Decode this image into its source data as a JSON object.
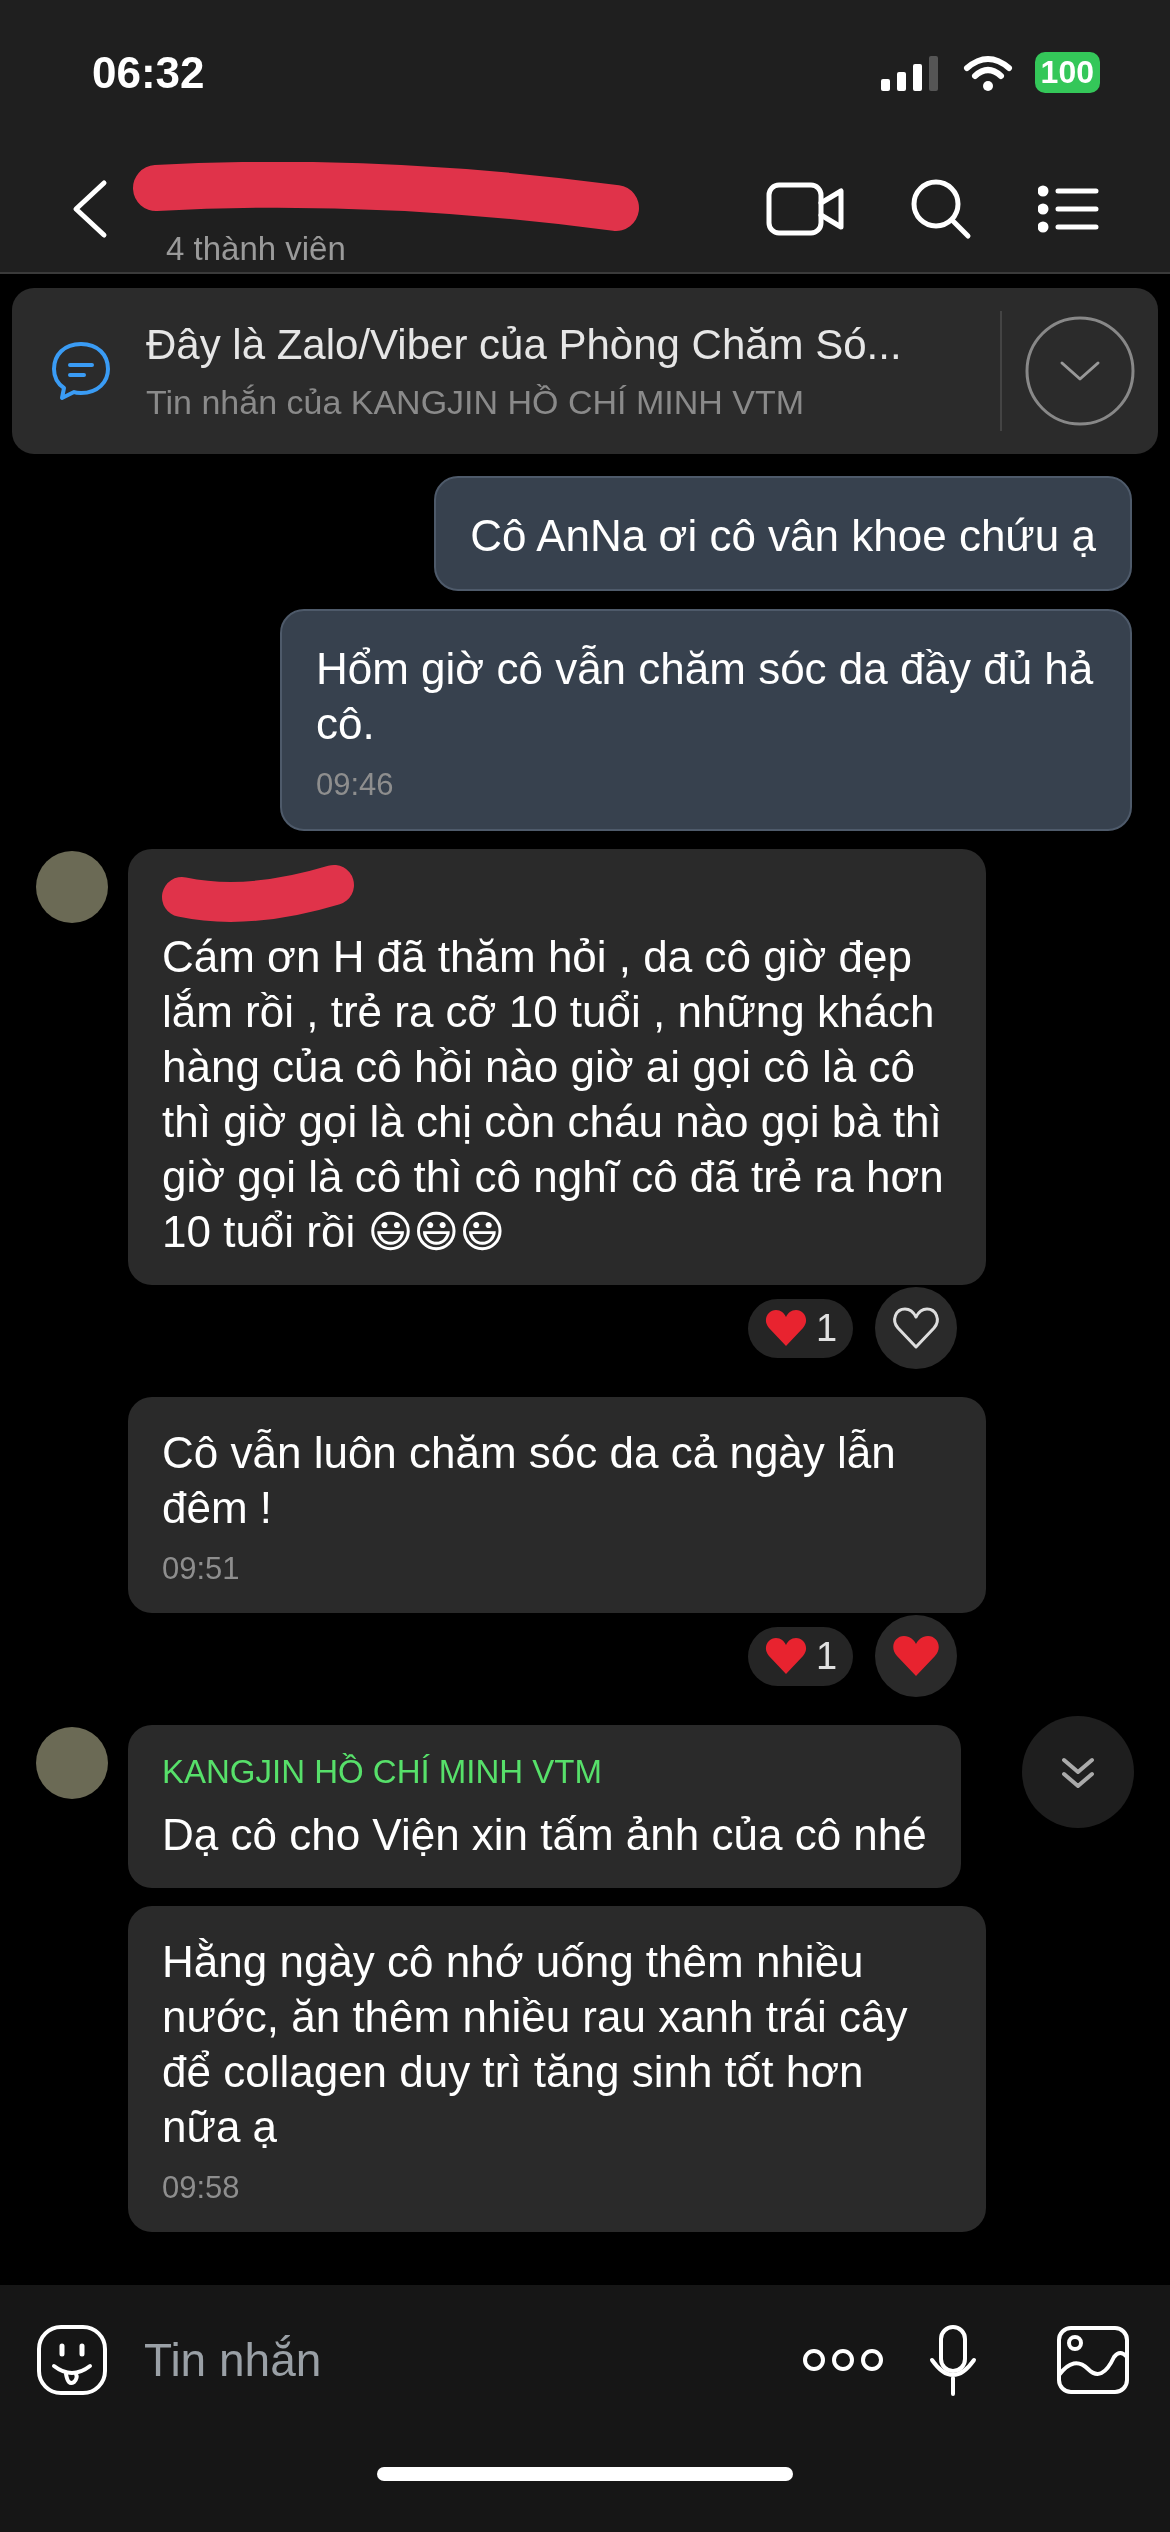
{
  "status_bar": {
    "time": "06:32",
    "battery": "100"
  },
  "header": {
    "title_redacted": true,
    "subtitle": "4 thành viên"
  },
  "pinned": {
    "text": "Đây là Zalo/Viber của Phòng Chăm Só...",
    "sender_line": "Tin nhắn của KANGJIN HỒ CHÍ MINH VTM"
  },
  "messages": [
    {
      "kind": "outgoing",
      "text": "Cô AnNa ơi cô vân khoe chứu ạ"
    },
    {
      "kind": "outgoing",
      "text": "Hổm giờ cô vẫn chăm sóc da đầy đủ hả cô.",
      "time": "09:46"
    },
    {
      "kind": "incoming",
      "avatar": true,
      "sender_redacted": true,
      "text": "Cám ơn H đã thăm hỏi , da cô giờ đẹp lắm rồi , trẻ ra cỡ 10 tuổi , những khách hàng của cô hồi nào giờ ai gọi cô là cô thì giờ gọi là chị còn cháu nào gọi bà thì giờ gọi là cô thì cô nghĩ cô đã trẻ ra hơn 10 tuổi rồi 😃😃😃",
      "reaction": {
        "count": "1",
        "liked": false
      }
    },
    {
      "kind": "incoming",
      "avatar": false,
      "text": "Cô vẫn luôn chăm sóc da cả ngày lẫn đêm !",
      "time": "09:51",
      "reaction": {
        "count": "1",
        "liked": true
      }
    },
    {
      "kind": "incoming",
      "avatar": true,
      "sender": "KANGJIN HỒ CHÍ MINH VTM",
      "text": "Dạ cô cho Viện xin tấm ảnh của cô nhé"
    },
    {
      "kind": "incoming",
      "avatar": false,
      "text": "Hằng ngày cô nhớ uống thêm nhiều nước, ăn thêm nhiều rau xanh trái cây để collagen duy trì tăng sinh tốt hơn nữa ạ",
      "time": "09:58"
    }
  ],
  "composer": {
    "placeholder": "Tin nhắn"
  }
}
